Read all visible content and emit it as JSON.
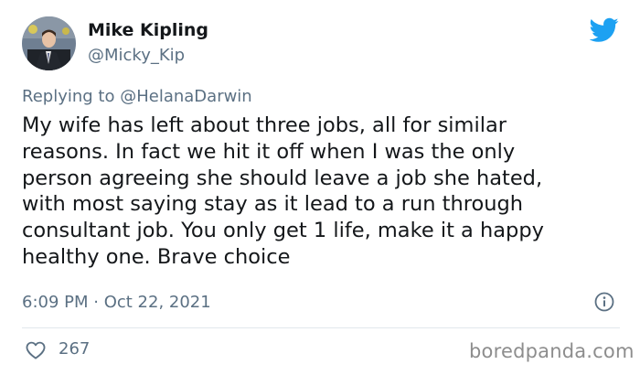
{
  "tweet": {
    "author_name": "Mike Kipling",
    "author_handle": "@Micky_Kip",
    "replying_prefix": "Replying to",
    "replying_to": "@HelanaDarwin",
    "body_lines": [
      "My wife has left about three jobs, all for similar",
      "reasons. In fact we hit it off when I was the only",
      "person agreeing she should leave a job she hated,",
      "with most saying stay as it lead to a run through",
      "consultant job. You only get 1 life, make it a happy",
      "healthy one. Brave choice"
    ],
    "timestamp": "6:09 PM · Oct 22, 2021",
    "like_count": "267"
  },
  "icons": {
    "avatar": "avatar",
    "brand": "twitter-bird-icon",
    "info": "info-icon",
    "like": "heart-icon"
  },
  "colors": {
    "twitter_blue": "#1da1f2",
    "text_primary": "#14171a",
    "text_secondary": "#5b7083",
    "divider": "#e1e8ed",
    "watermark": "#8d8d8d"
  },
  "watermark": "boredpanda.com"
}
